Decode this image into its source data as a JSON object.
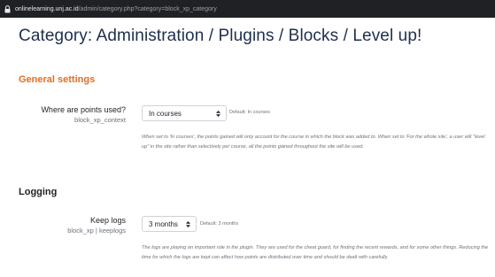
{
  "browser": {
    "domain": "onlinelearning.unj.ac.id",
    "path": "/admin/category.php?category=block_xp_category"
  },
  "page": {
    "title": "Category: Administration / Plugins / Blocks / Level up!"
  },
  "general": {
    "heading": "General settings",
    "points_setting": {
      "label": "Where are points used?",
      "sublabel": "block_xp_context",
      "value": "In courses",
      "default_text": "Default: In courses",
      "help": "When set to 'In courses', the points gained will only account for the course in which the block was added to. When set to 'For the whole site', a user will \"level up\" in the site rather than selectively per course, all the points gained throughout the site will be used."
    }
  },
  "logging": {
    "heading": "Logging",
    "keep_logs": {
      "label": "Keep logs",
      "sublabel": "block_xp | keeplogs",
      "value": "3 months",
      "default_text": "Default: 3 months",
      "help": "The logs are playing an important role in the plugin. They are used for the cheat guard, for finding the recent rewards, and for some other things. Reducing the time for which the logs are kept can affect how points are distributed over time and should be dealt with carefully."
    }
  },
  "colors": {
    "section_accent": "#e06f1f",
    "title": "#1e2f4d",
    "address_bar": "#202124"
  }
}
